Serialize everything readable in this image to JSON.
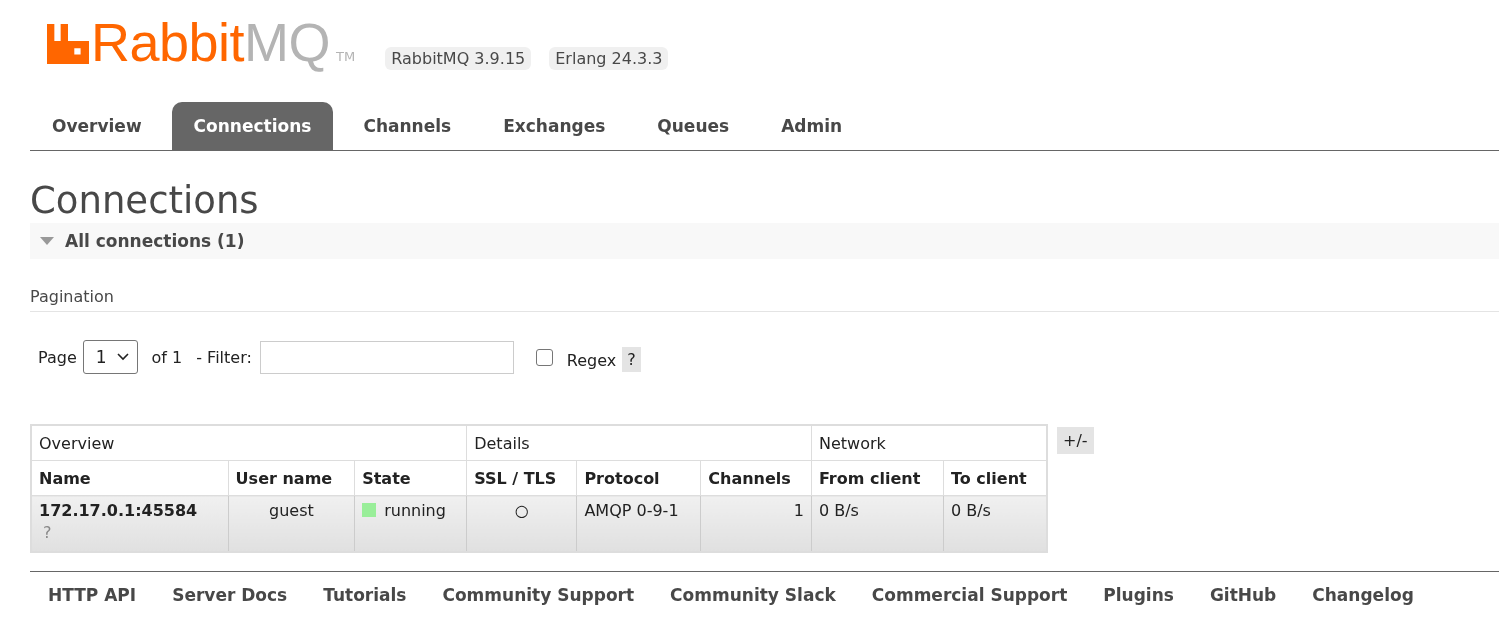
{
  "header": {
    "logo": {
      "brand": "Rabbit",
      "brand_suffix": "MQ",
      "trademark": "TM"
    },
    "versions": [
      "RabbitMQ 3.9.15",
      "Erlang 24.3.3"
    ]
  },
  "tabs": [
    {
      "label": "Overview",
      "selected": false
    },
    {
      "label": "Connections",
      "selected": true
    },
    {
      "label": "Channels",
      "selected": false
    },
    {
      "label": "Exchanges",
      "selected": false
    },
    {
      "label": "Queues",
      "selected": false
    },
    {
      "label": "Admin",
      "selected": false
    }
  ],
  "page_title": "Connections",
  "section": {
    "title": "All connections (1)",
    "expanded": true
  },
  "pagination": {
    "heading": "Pagination",
    "page_label": "Page",
    "page_value": "1",
    "of_label": "of 1",
    "filter_label": "- Filter:",
    "regex": {
      "label": "Regex",
      "checked": false
    },
    "help": "?"
  },
  "table": {
    "groups": [
      "Overview",
      "Details",
      "Network"
    ],
    "columns": [
      "Name",
      "User name",
      "State",
      "SSL / TLS",
      "Protocol",
      "Channels",
      "From client",
      "To client"
    ],
    "rows": [
      {
        "name": "172.17.0.1:45584",
        "name_note": "?",
        "user": "guest",
        "state": {
          "label": "running",
          "color": "#99ee99"
        },
        "ssl": "○",
        "protocol": "AMQP 0-9-1",
        "channels": "1",
        "from_client": "0 B/s",
        "to_client": "0 B/s"
      }
    ],
    "toggle": "+/-"
  },
  "footer": [
    "HTTP API",
    "Server Docs",
    "Tutorials",
    "Community Support",
    "Community Slack",
    "Commercial Support",
    "Plugins",
    "GitHub",
    "Changelog"
  ]
}
